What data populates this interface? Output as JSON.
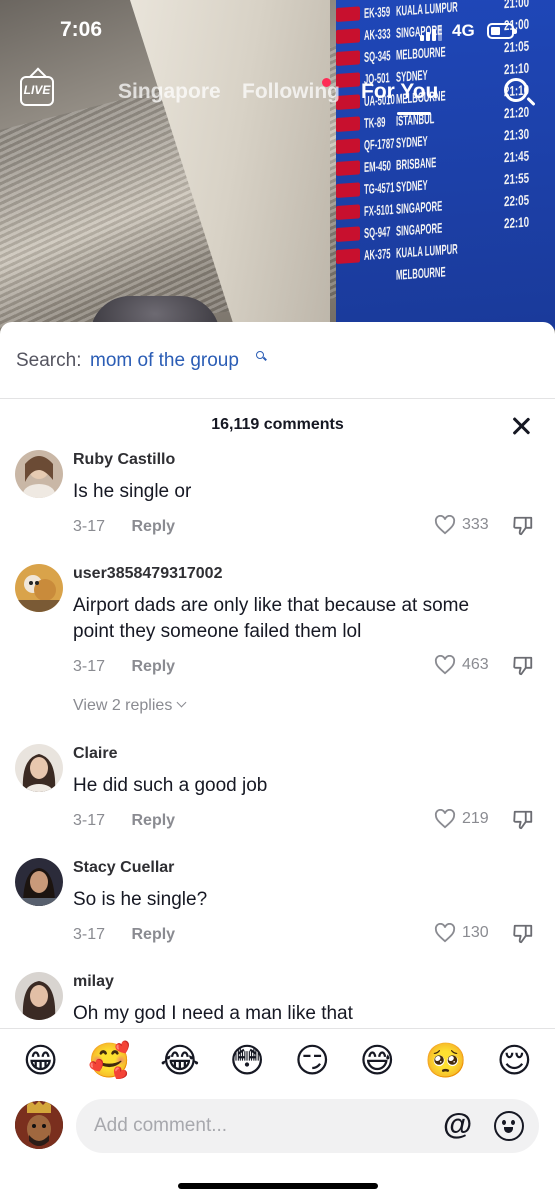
{
  "status_bar": {
    "time": "7:06",
    "network": "4G"
  },
  "top_nav": {
    "live_label": "LIVE",
    "tabs": [
      {
        "label": "Singapore",
        "active": false
      },
      {
        "label": "Following",
        "active": false
      },
      {
        "label": "For You",
        "active": true
      }
    ]
  },
  "video_board": {
    "codes": [
      "EK-359",
      "AK-333",
      "SQ-345",
      "JQ-501",
      "UA-5010",
      "TK-89",
      "QF-1787",
      "EM-450",
      "TG-4571",
      "FX-5101",
      "SQ-947",
      "AK-375"
    ],
    "destinations": [
      "KUALA LUMPUR",
      "SINGAPORE",
      "MELBOURNE",
      "SYDNEY",
      "MELBOURNE",
      "ISTANBUL",
      "SYDNEY",
      "BRISBANE",
      "SYDNEY",
      "SINGAPORE",
      "SINGAPORE",
      "KUALA LUMPUR",
      "MELBOURNE"
    ],
    "times": [
      "21:00",
      "21:00",
      "21:05",
      "21:10",
      "21:10",
      "21:20",
      "21:30",
      "21:45",
      "21:55",
      "22:05",
      "22:10"
    ]
  },
  "comment_sheet": {
    "search_prefix": "Search:",
    "search_term": "mom of the group",
    "count_label": "16,119 comments",
    "comments": [
      {
        "username": "Ruby Castillo",
        "text": "Is he single or",
        "date": "3-17",
        "reply_label": "Reply",
        "likes": "333"
      },
      {
        "username": "user3858479317002",
        "text": "Airport dads are only like that because at some point they someone failed them lol",
        "date": "3-17",
        "reply_label": "Reply",
        "likes": "463",
        "view_replies": "View 2 replies"
      },
      {
        "username": "Claire",
        "text": "He did such a good job",
        "date": "3-17",
        "reply_label": "Reply",
        "likes": "219"
      },
      {
        "username": "Stacy Cuellar",
        "text": "So is he single?",
        "date": "3-17",
        "reply_label": "Reply",
        "likes": "130"
      },
      {
        "username": "milay",
        "text": "Oh my god I need a man like that"
      }
    ],
    "emojis": [
      "😁",
      "🥰",
      "😂",
      "😳",
      "😏",
      "😅",
      "🥺",
      "😌"
    ],
    "input": {
      "placeholder": "Add comment...",
      "value": "",
      "mention_symbol": "@"
    }
  },
  "colors": {
    "accent_link": "#2b5db5",
    "notification_dot": "#fe2c55",
    "meta_text": "#8a8b91"
  },
  "icons": [
    "live-icon",
    "search-icon",
    "close-icon",
    "heart-icon",
    "dislike-icon",
    "chevron-down-icon",
    "emoji-icon",
    "at-mention-icon"
  ]
}
